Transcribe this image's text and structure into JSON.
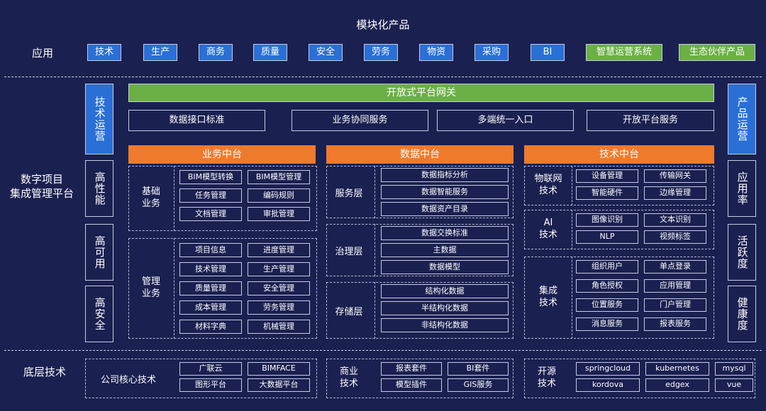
{
  "title": "模块化产品",
  "app_row": {
    "label": "应用",
    "items": [
      "技术",
      "生产",
      "商务",
      "质量",
      "安全",
      "劳务",
      "物资",
      "采购",
      "BI"
    ],
    "green_items": [
      "智慧运营系统",
      "生态伙伴产品"
    ]
  },
  "left_title": "数字项目\n集成管理平台",
  "left_pillars": [
    "技术运营",
    "高性能",
    "高可用",
    "高安全"
  ],
  "right_pillars": [
    "产品运营",
    "应用率",
    "活跃度",
    "健康度"
  ],
  "gateway": "开放式平台网关",
  "gateway_items": [
    "数据接口标准",
    "业务协同服务",
    "多端统一入口",
    "开放平台服务"
  ],
  "business": {
    "header": "业务中台",
    "base_label": "基础\n业务",
    "base_items": [
      "BIM模型转换",
      "BIM模型管理",
      "任务管理",
      "编码规则",
      "文档管理",
      "审批管理"
    ],
    "mgmt_label": "管理\n业务",
    "mgmt_items": [
      "项目信息",
      "进度管理",
      "技术管理",
      "生产管理",
      "质量管理",
      "安全管理",
      "成本管理",
      "劳务管理",
      "材料字典",
      "机械管理"
    ]
  },
  "data": {
    "header": "数据中台",
    "layers": [
      {
        "label": "服务层",
        "items": [
          "数据指标分析",
          "数据智能服务",
          "数据资产目录"
        ]
      },
      {
        "label": "治理层",
        "items": [
          "数据交换标准",
          "主数据",
          "数据模型"
        ]
      },
      {
        "label": "存储层",
        "items": [
          "结构化数据",
          "半结构化数据",
          "非结构化数据"
        ]
      }
    ]
  },
  "tech": {
    "header": "技术中台",
    "groups": [
      {
        "label": "物联网\n技术",
        "items": [
          "设备管理",
          "传输网关",
          "智能硬件",
          "边缘管理"
        ]
      },
      {
        "label": "AI\n技术",
        "items": [
          "图像识别",
          "文本识别",
          "NLP",
          "视频标签"
        ]
      },
      {
        "label": "集成\n技术",
        "items": [
          "组织用户",
          "单点登录",
          "角色授权",
          "应用管理",
          "位置服务",
          "门户管理",
          "消息服务",
          "报表服务"
        ]
      }
    ]
  },
  "bottom": {
    "label": "底层技术",
    "core_label": "公司核心技术",
    "core_items": [
      "广联云",
      "BIMFACE",
      "图形平台",
      "大数据平台"
    ],
    "biz_label": "商业\n技术",
    "biz_items": [
      "报表套件",
      "BI套件",
      "模型插件",
      "GIS服务"
    ],
    "os_label": "开源\n技术",
    "os_items": [
      "springcloud",
      "kubernetes",
      "mysql",
      "kordova",
      "edgex",
      "vue"
    ]
  },
  "colors": {
    "background": "#1a2050",
    "blue": "#2a6fd6",
    "green": "#6ab045",
    "orange": "#ef7a2b"
  }
}
